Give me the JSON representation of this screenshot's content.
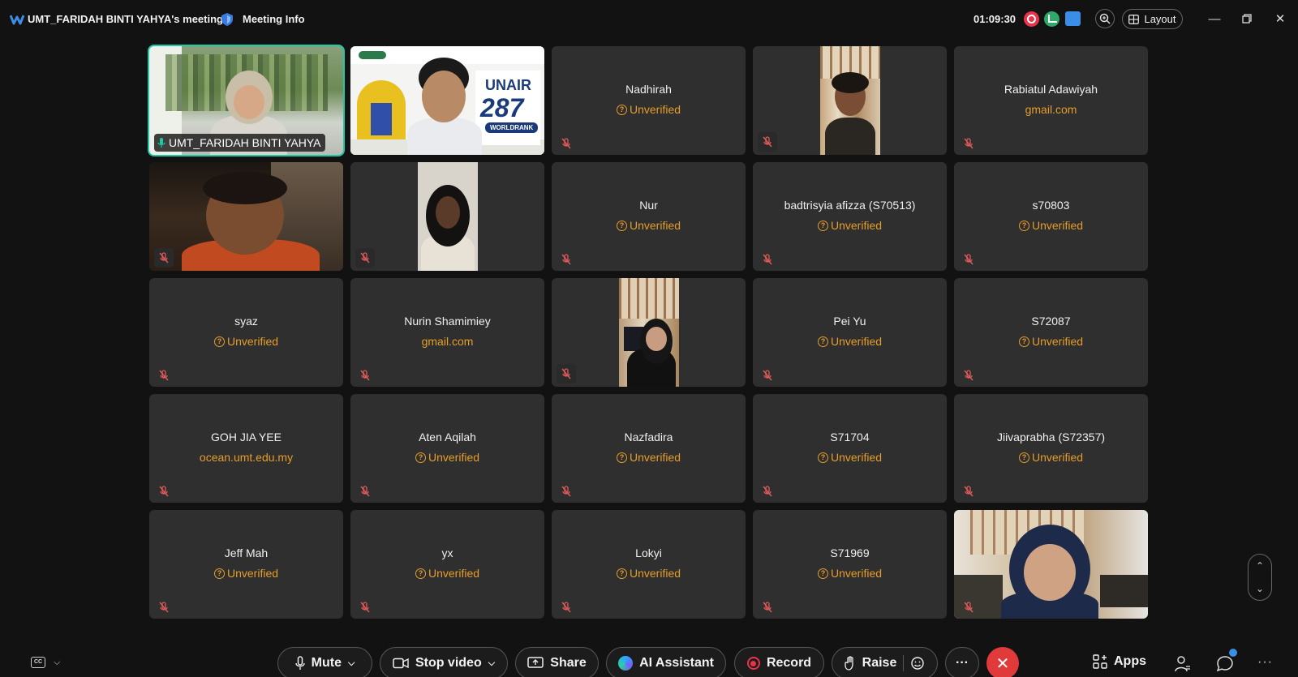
{
  "topbar": {
    "meeting_title": "UMT_FARIDAH BINTI YAHYA's meeting",
    "meeting_info": "Meeting Info",
    "timer": "01:09:30",
    "layout_label": "Layout"
  },
  "tiles": [
    {
      "name": "UMT_FARIDAH BINTI YAHYA",
      "kind": "video"
    },
    {
      "name": "",
      "kind": "video"
    },
    {
      "name": "Nadhirah",
      "sub": "Unverified",
      "kind": "text"
    },
    {
      "name": "",
      "kind": "video"
    },
    {
      "name": "Rabiatul Adawiyah",
      "sub": "gmail.com",
      "kind": "text"
    },
    {
      "name": "",
      "kind": "video"
    },
    {
      "name": "",
      "kind": "video"
    },
    {
      "name": "Nur",
      "sub": "Unverified",
      "kind": "text"
    },
    {
      "name": "badtrisyia afizza (S70513)",
      "sub": "Unverified",
      "kind": "text"
    },
    {
      "name": "s70803",
      "sub": "Unverified",
      "kind": "text"
    },
    {
      "name": "syaz",
      "sub": "Unverified",
      "kind": "text"
    },
    {
      "name": "Nurin Shamimiey",
      "sub": "gmail.com",
      "kind": "text"
    },
    {
      "name": "",
      "kind": "video"
    },
    {
      "name": "Pei Yu",
      "sub": "Unverified",
      "kind": "text"
    },
    {
      "name": "S72087",
      "sub": "Unverified",
      "kind": "text"
    },
    {
      "name": "GOH JIA YEE",
      "sub": "ocean.umt.edu.my",
      "kind": "text"
    },
    {
      "name": "Aten Aqilah",
      "sub": "Unverified",
      "kind": "text"
    },
    {
      "name": "Nazfadira",
      "sub": "Unverified",
      "kind": "text"
    },
    {
      "name": "S71704",
      "sub": "Unverified",
      "kind": "text"
    },
    {
      "name": "Jiivaprabha (S72357)",
      "sub": "Unverified",
      "kind": "text"
    },
    {
      "name": "Jeff Mah",
      "sub": "Unverified",
      "kind": "text"
    },
    {
      "name": "yx",
      "sub": "Unverified",
      "kind": "text"
    },
    {
      "name": "Lokyi",
      "sub": "Unverified",
      "kind": "text"
    },
    {
      "name": "S71969",
      "sub": "Unverified",
      "kind": "text"
    },
    {
      "name": "",
      "kind": "video"
    }
  ],
  "banner": {
    "brand": "UNAIR",
    "rank": "287",
    "caption": "WORLDRANK"
  },
  "controls": {
    "mute": "Mute",
    "stop_video": "Stop video",
    "share": "Share",
    "ai_assistant": "AI Assistant",
    "record": "Record",
    "raise": "Raise",
    "more": "···",
    "apps": "Apps",
    "more_right": "···"
  },
  "colors": {
    "accent_active": "#1ec9a6",
    "unverified": "#e69d2a",
    "end_call": "#e03a3a",
    "tile_bg": "#2f2f2f",
    "background": "#121212"
  }
}
